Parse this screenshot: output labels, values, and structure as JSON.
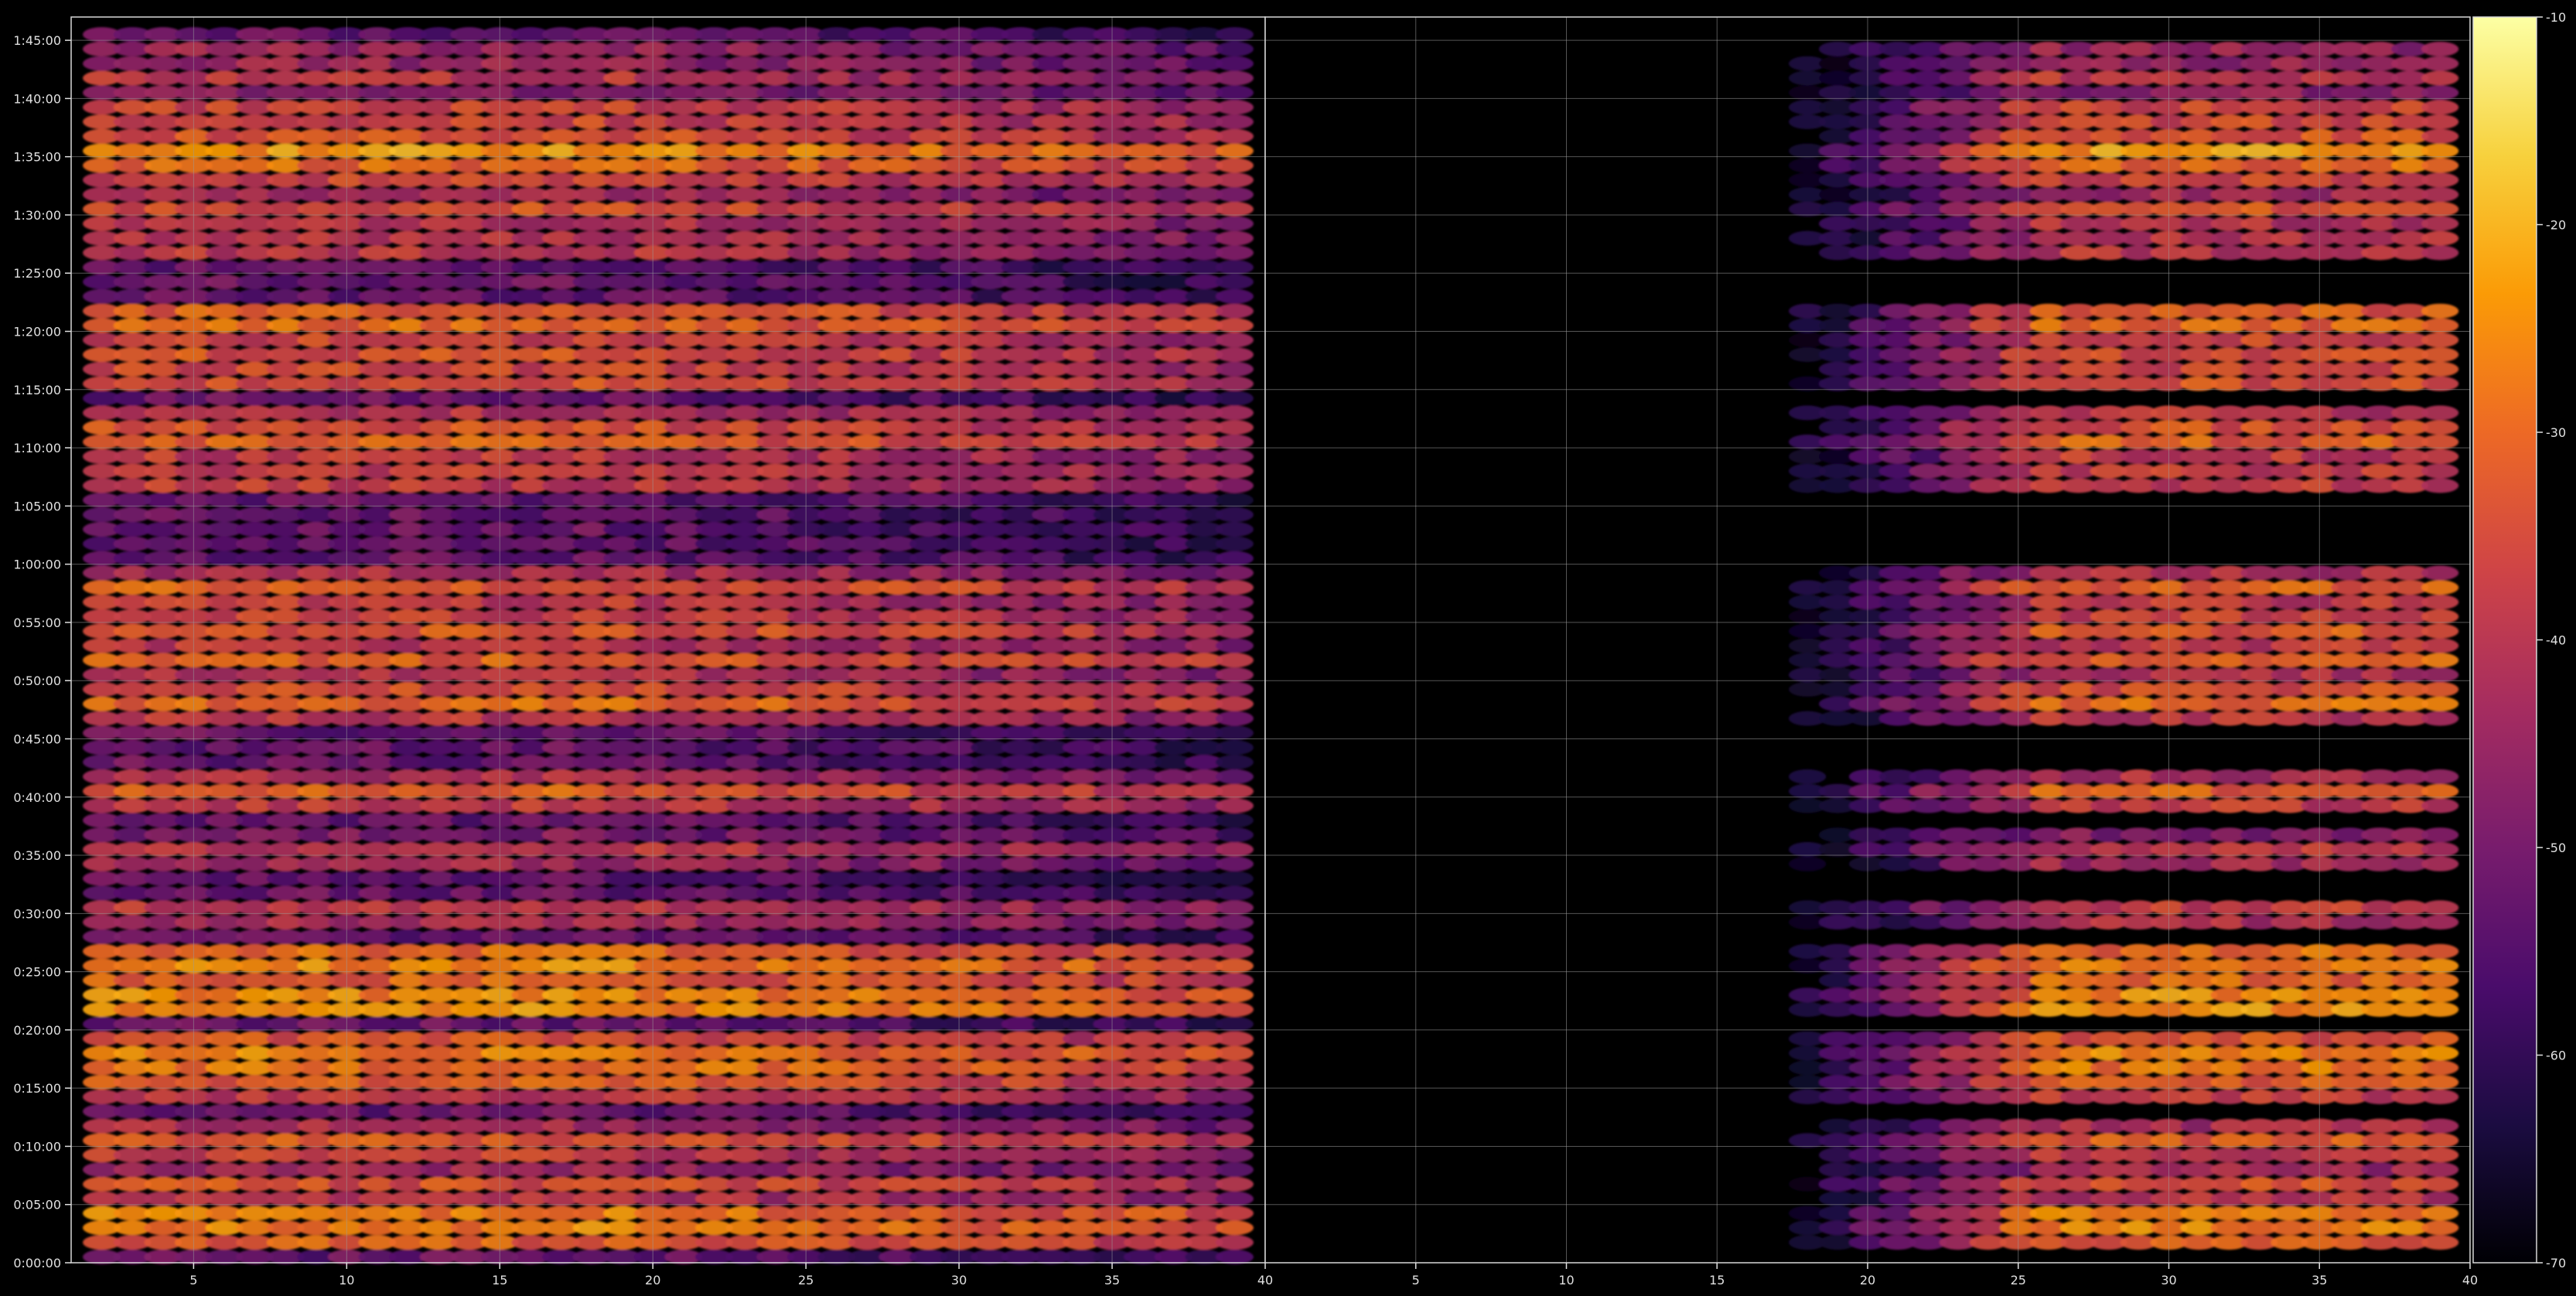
{
  "chart_data": {
    "type": "heatmap",
    "title": "",
    "xlabel": "",
    "ylabel": "",
    "background": "#000000",
    "grid": true,
    "grid_color": "#9a9a9a",
    "colormap": "inferno",
    "colormap_stops": [
      "#000004",
      "#1b0c41",
      "#4a0c6b",
      "#781c6d",
      "#a52c60",
      "#cf4446",
      "#ed6925",
      "#fb9b06",
      "#f7d13d",
      "#fcffa4"
    ],
    "colorbar": {
      "range": [
        -70,
        -10
      ],
      "ticks": [
        -10,
        -20,
        -30,
        -40,
        -50,
        -60,
        -70
      ],
      "labels": [
        "-10",
        "-20",
        "-30",
        "-40",
        "-50",
        "-60",
        "-70"
      ]
    },
    "yaxis": {
      "range_minutes": [
        0,
        107
      ],
      "ticks_minutes": [
        0,
        5,
        10,
        15,
        20,
        25,
        30,
        35,
        40,
        45,
        50,
        55,
        60,
        65,
        70,
        75,
        80,
        85,
        90,
        95,
        100,
        105
      ],
      "tick_labels": [
        "0:00:00",
        "0:05:00",
        "0:10:00",
        "0:15:00",
        "0:20:00",
        "0:25:00",
        "0:30:00",
        "0:35:00",
        "0:40:00",
        "0:45:00",
        "0:50:00",
        "0:55:00",
        "1:00:00",
        "1:05:00",
        "1:10:00",
        "1:15:00",
        "1:20:00",
        "1:25:00",
        "1:30:00",
        "1:35:00",
        "1:40:00",
        "1:45:00"
      ]
    },
    "panels": [
      {
        "x_range": [
          1,
          40
        ],
        "channels": [
          2,
          39
        ],
        "x_ticks": [
          5,
          10,
          15,
          20,
          25,
          30,
          35,
          40
        ],
        "x_tick_labels": [
          "5",
          "10",
          "15",
          "20",
          "25",
          "30",
          "35",
          "40"
        ],
        "base_level": -52,
        "fade": {
          "from": 18,
          "to": 39,
          "drop": 8
        }
      },
      {
        "x_range": [
          0,
          40
        ],
        "channels": [
          1,
          39
        ],
        "x_ticks": [
          5,
          10,
          15,
          20,
          25,
          30,
          35,
          40
        ],
        "x_tick_labels": [
          "5",
          "10",
          "15",
          "20",
          "25",
          "30",
          "35",
          "40"
        ],
        "base_level": -75,
        "rise": {
          "from": 18,
          "to": 26,
          "gain": 22
        }
      }
    ],
    "bands_minutes": [
      {
        "t": 2.2,
        "level": -28
      },
      {
        "t": 3.6,
        "level": -22
      },
      {
        "t": 6.5,
        "level": -32
      },
      {
        "t": 10.2,
        "level": -30
      },
      {
        "t": 15.3,
        "level": -30
      },
      {
        "t": 17.0,
        "level": -26
      },
      {
        "t": 18.2,
        "level": -25
      },
      {
        "t": 22.1,
        "level": -22
      },
      {
        "t": 23.3,
        "level": -23
      },
      {
        "t": 25.5,
        "level": -25
      },
      {
        "t": 26.4,
        "level": -27
      },
      {
        "t": 30.1,
        "level": -35
      },
      {
        "t": 35.2,
        "level": -36
      },
      {
        "t": 40.3,
        "level": -30
      },
      {
        "t": 48.3,
        "level": -27
      },
      {
        "t": 51.9,
        "level": -30
      },
      {
        "t": 54.6,
        "level": -30
      },
      {
        "t": 57.8,
        "level": -30
      },
      {
        "t": 67.4,
        "level": -33
      },
      {
        "t": 70.3,
        "level": -30
      },
      {
        "t": 72.0,
        "level": -32
      },
      {
        "t": 76.0,
        "level": -30
      },
      {
        "t": 78.5,
        "level": -30
      },
      {
        "t": 81.0,
        "level": -26
      },
      {
        "t": 87.3,
        "level": -35
      },
      {
        "t": 90.3,
        "level": -32
      },
      {
        "t": 94.0,
        "level": -28
      },
      {
        "t": 95.3,
        "level": -22
      },
      {
        "t": 98.6,
        "level": -31
      },
      {
        "t": 101.6,
        "level": -38
      },
      {
        "t": 103.6,
        "level": -40
      }
    ]
  }
}
